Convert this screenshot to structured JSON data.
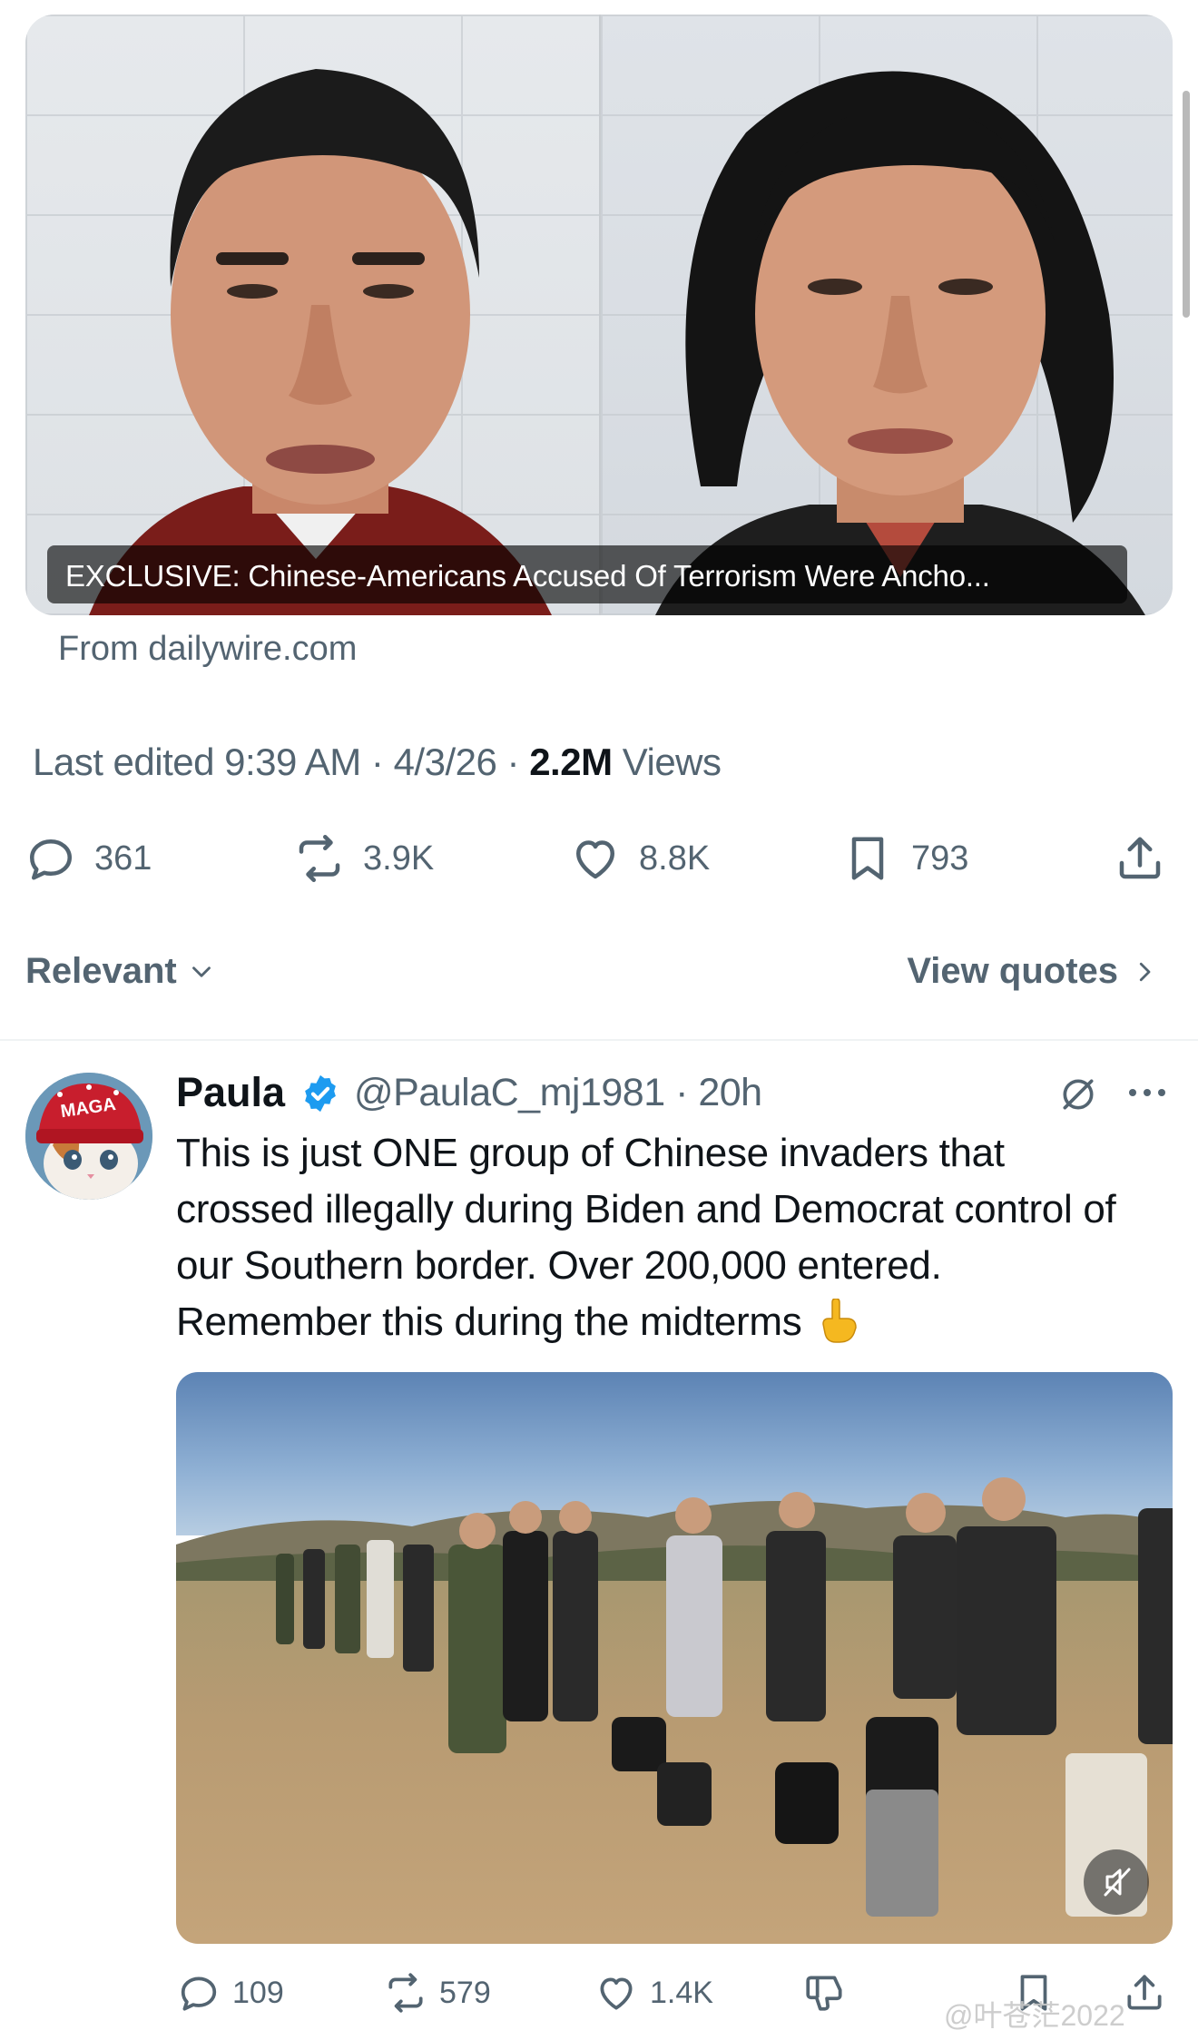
{
  "link_card": {
    "headline": "EXCLUSIVE: Chinese-Americans Accused Of Terrorism Were Ancho...",
    "from": "From dailywire.com"
  },
  "post_meta": {
    "edited": "Last edited 9:39 AM · 4/3/26",
    "separator": " · ",
    "views_count": "2.2M",
    "views_label": " Views"
  },
  "actions": {
    "replies": "361",
    "reposts": "3.9K",
    "likes": "8.8K",
    "bookmarks": "793"
  },
  "sort": {
    "relevant": "Relevant",
    "view_quotes": "View quotes"
  },
  "reply": {
    "avatar_text": "MAGA",
    "name": "Paula",
    "handle": "@PaulaC_mj1981 · 20h",
    "text": "This is just ONE group of Chinese invaders that crossed illegally during Biden and Democrat control of our Southern border. Over 200,000 entered. Remember this during the midterms",
    "actions": {
      "replies": "109",
      "reposts": "579",
      "likes": "1.4K"
    }
  },
  "watermark": "@叶苍茫2022",
  "colors": {
    "text_primary": "#0f1419",
    "text_secondary": "#536471",
    "verified_blue": "#1d9bf0"
  }
}
